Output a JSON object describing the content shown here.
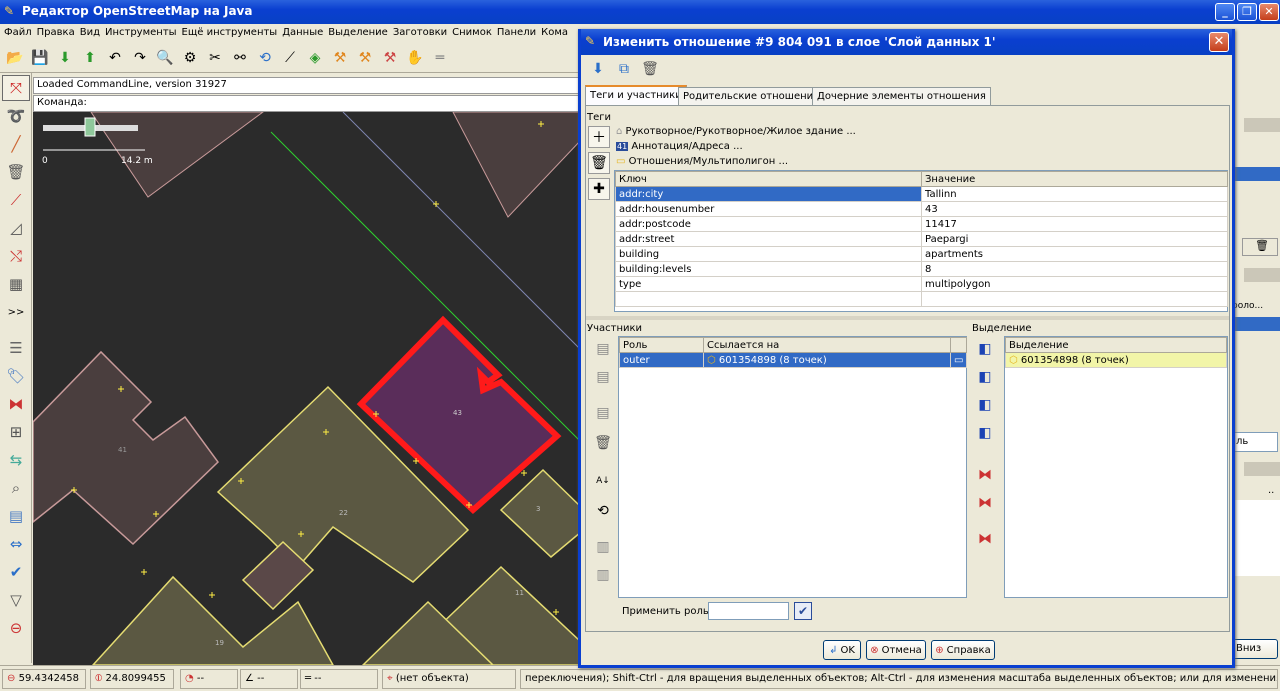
{
  "window": {
    "title": "Редактор OpenStreetMap на Java"
  },
  "menu": [
    "Файл",
    "Правка",
    "Вид",
    "Инструменты",
    "Ещё инструменты",
    "Данные",
    "Выделение",
    "Заготовки",
    "Снимок",
    "Панели",
    "Кома"
  ],
  "command_line": {
    "output": "Loaded CommandLine, version 31927",
    "prompt": "Команда:"
  },
  "map": {
    "scale": {
      "zero": "0",
      "distance": "14.2 m"
    },
    "labels": {
      "b41": "41",
      "b43": "43",
      "b22": "22",
      "b3": "3",
      "b11": "11",
      "b19": "19"
    }
  },
  "status": {
    "lat": "59.4342458",
    "lon": "24.8099455",
    "heading": "--",
    "angle": "--",
    "length": "--",
    "object": "(нет объекта)",
    "help": "переключения); Shift-Ctrl - для вращения выделенных объектов; Alt-Ctrl - для изменения масштаба выделенных объектов; или для изменения выделения"
  },
  "right_panel": {
    "button_a": "ль",
    "button_b": "Вниз",
    "header_a": "..",
    "header_b": "роло..."
  },
  "dialog": {
    "title": "Изменить отношение #9 804 091 в слое 'Слой данных 1'",
    "tabs": [
      "Теги и участники",
      "Родительские отношения",
      "Дочерние элементы отношения"
    ],
    "tags_label": "Теги",
    "presets": [
      "Рукотворное/Рукотворное/Жилое здание ...",
      "Аннотация/Адреса ...",
      "Отношения/Мультиполигон ..."
    ],
    "tag_columns": {
      "key": "Ключ",
      "value": "Значение"
    },
    "tags": [
      {
        "key": "addr:city",
        "value": "Tallinn"
      },
      {
        "key": "addr:housenumber",
        "value": "43"
      },
      {
        "key": "addr:postcode",
        "value": "11417"
      },
      {
        "key": "addr:street",
        "value": "Paepargi"
      },
      {
        "key": "building",
        "value": "apartments"
      },
      {
        "key": "building:levels",
        "value": "8"
      },
      {
        "key": "type",
        "value": "multipolygon"
      }
    ],
    "members_label": "Участники",
    "member_columns": {
      "role": "Роль",
      "ref": "Ссылается на"
    },
    "members": [
      {
        "role": "outer",
        "ref": "601354898 (8 точек)"
      }
    ],
    "apply_role_label": "Применить роль:",
    "apply_role_value": "",
    "selection_label": "Выделение",
    "selection_column": "Выделение",
    "selection": [
      "601354898 (8 точек)"
    ],
    "buttons": {
      "ok": "OK",
      "cancel": "Отмена",
      "help": "Справка"
    }
  }
}
